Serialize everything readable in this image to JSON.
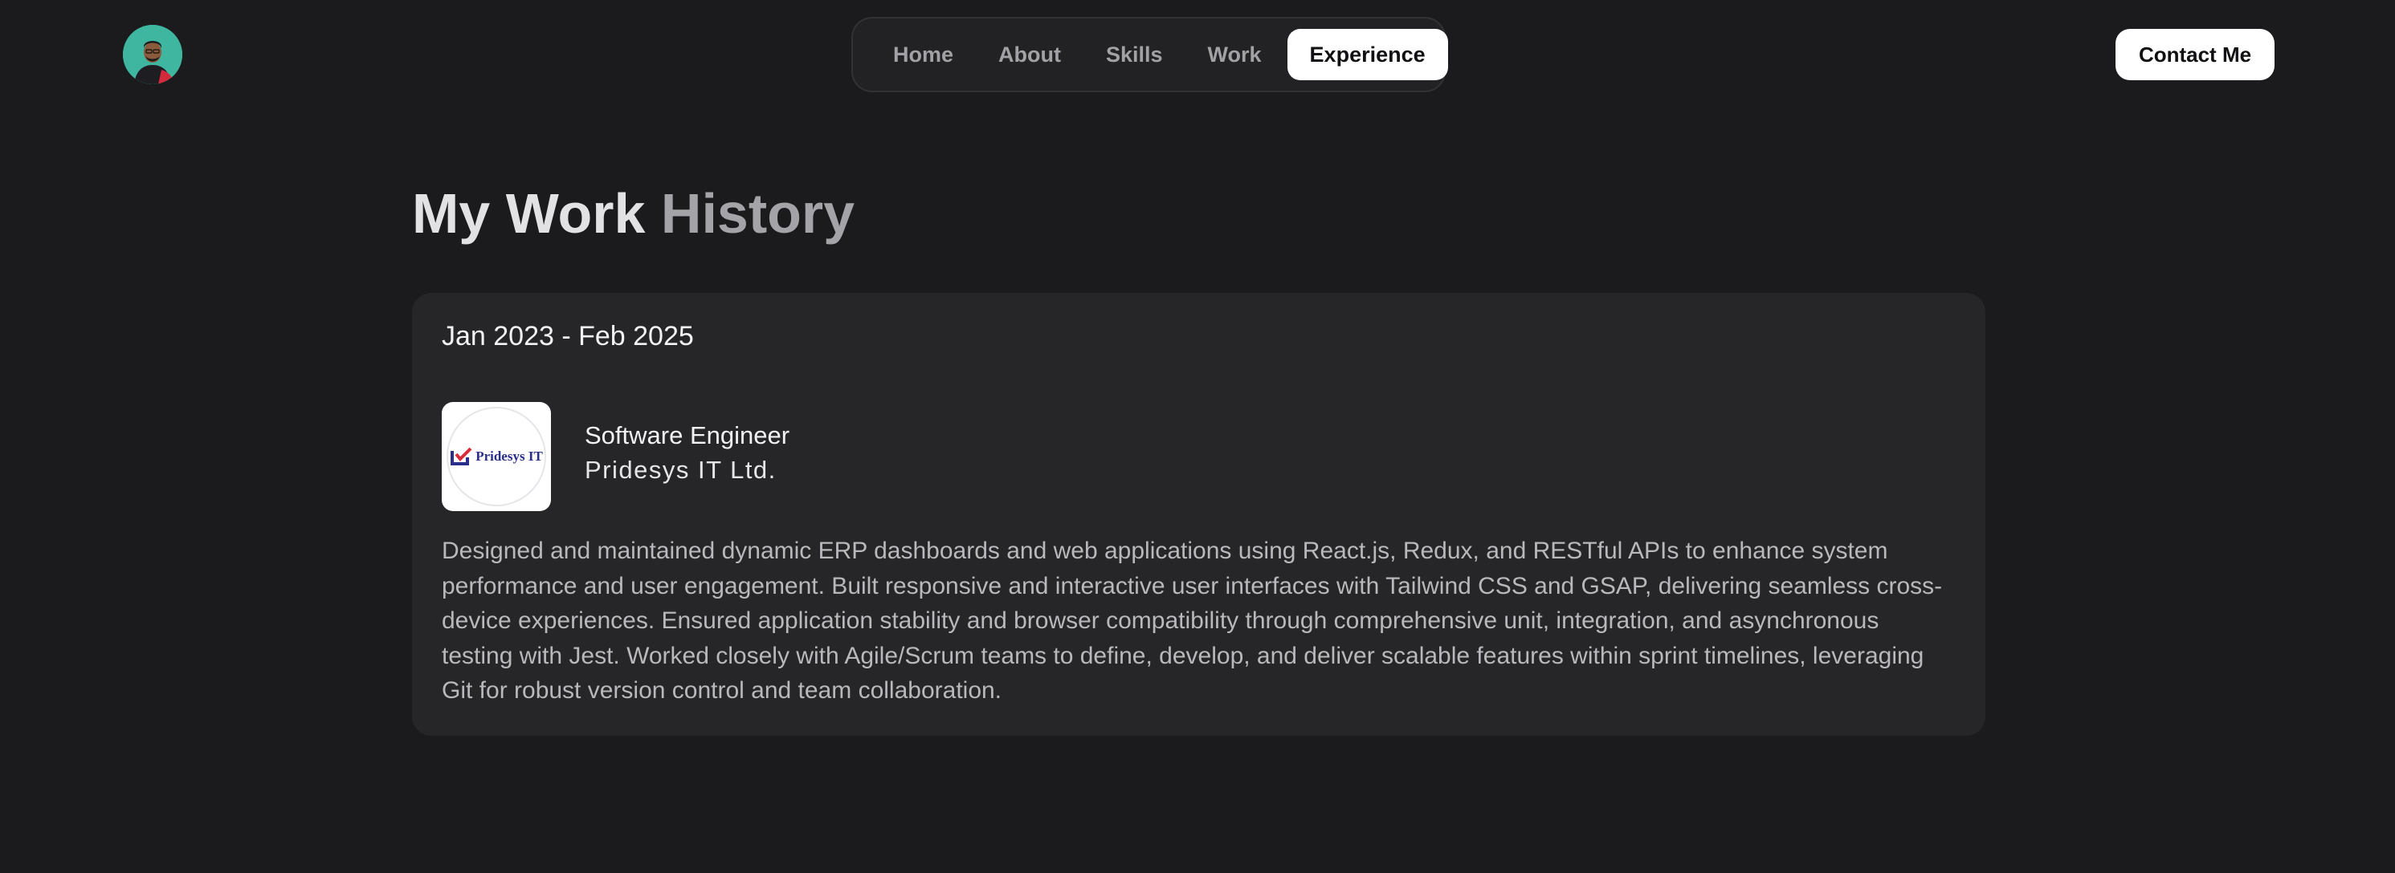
{
  "header": {
    "nav": [
      {
        "label": "Home",
        "active": false
      },
      {
        "label": "About",
        "active": false
      },
      {
        "label": "Skills",
        "active": false
      },
      {
        "label": "Work",
        "active": false
      },
      {
        "label": "Experience",
        "active": true
      }
    ],
    "contact_label": "Contact Me"
  },
  "main": {
    "title_part1": "My Work",
    "title_part2": "History",
    "experience": {
      "date_range": "Jan 2023 - Feb 2025",
      "role": "Software Engineer",
      "company": "Pridesys IT Ltd.",
      "logo_text": "Pridesys IT",
      "description": "Designed and maintained dynamic ERP dashboards and web applications using React.js, Redux, and RESTful APIs to enhance system performance and user engagement. Built responsive and interactive user interfaces with Tailwind CSS and GSAP, delivering seamless cross-device experiences. Ensured application stability and browser compatibility through comprehensive unit, integration, and asynchronous testing with Jest. Worked closely with Agile/Scrum teams to define, develop, and deliver scalable features within sprint timelines, leveraging Git for robust version control and team collaboration."
    }
  },
  "colors": {
    "background": "#1b1b1d",
    "card": "#262628",
    "avatar_bg": "#3fb6a0",
    "logo_brand": "#2a2f8c",
    "logo_accent": "#d92b3a"
  },
  "icons": {
    "avatar": "profile-photo",
    "company_logo": "pridesys-logo"
  }
}
